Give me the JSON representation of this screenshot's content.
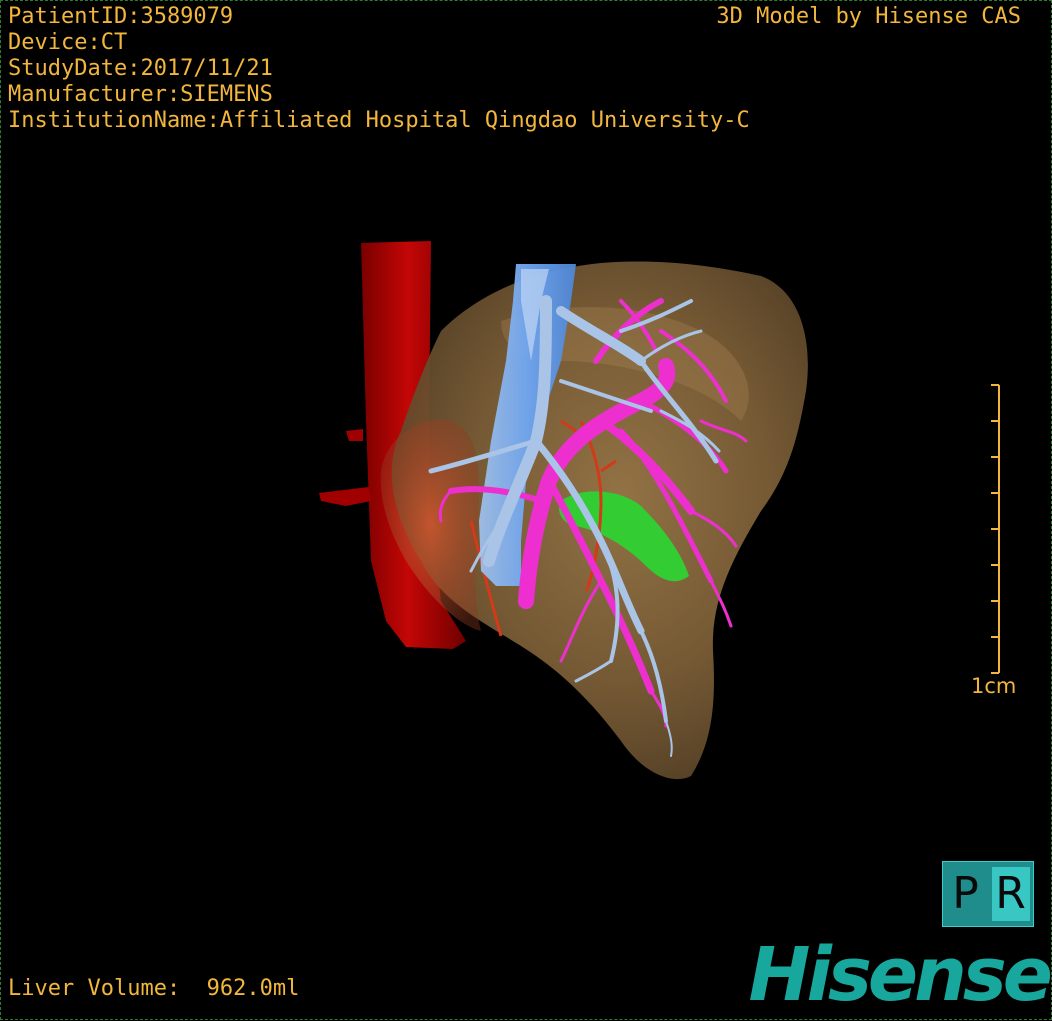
{
  "overlay": {
    "patient_id": "PatientID:3589079",
    "device": "Device:CT",
    "study_date": "StudyDate:2017/11/21",
    "manufacturer": "Manufacturer:SIEMENS",
    "institution": "InstitutionName:Affiliated Hospital Qingdao University-C",
    "credit": "3D Model by Hisense CAS",
    "liver_volume": "Liver Volume:  962.0ml"
  },
  "scale": {
    "label": "1cm",
    "ticks": 9
  },
  "badge": {
    "left_letter": "P",
    "right_letter": "R"
  },
  "brand": {
    "name": "Hisense",
    "color": "#17a79d"
  },
  "colors": {
    "overlay_text": "#f2b63c",
    "liver": "#8a6a3e",
    "aorta": "#b30000",
    "hepatic_vein": "#a9c4e6",
    "portal_vein": "#ee2fd0",
    "gallbladder": "#33cc33",
    "ivc": "#6fa6f2"
  }
}
